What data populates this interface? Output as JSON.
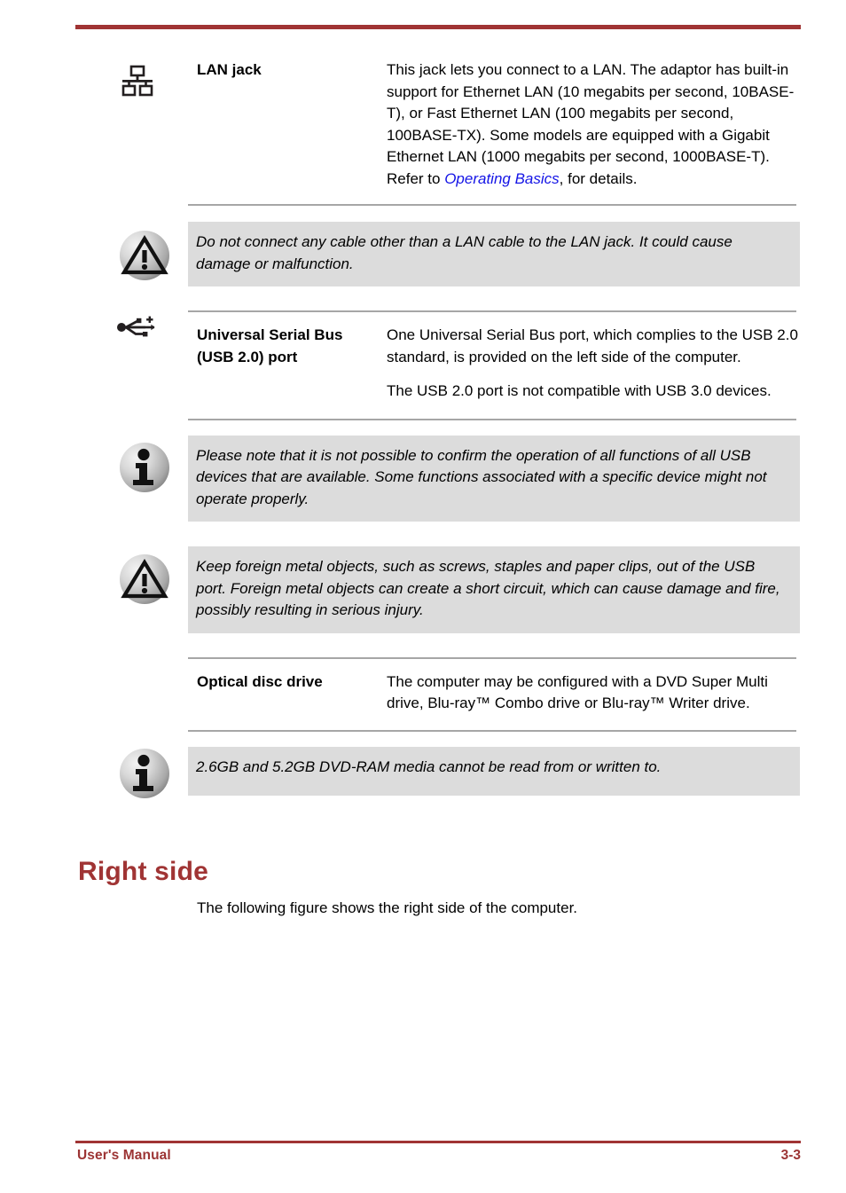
{
  "header": {
    "rule_color": "#a03434"
  },
  "footer": {
    "manual_label": "User's Manual",
    "page_number": "3-3",
    "color": "#9c3434"
  },
  "sections": {
    "lan": {
      "icon": "lan-jack-icon",
      "label": "LAN jack",
      "description_before_link": "This jack lets you connect to a LAN. The adaptor has built-in support for Ethernet LAN (10 megabits per second, 10BASE-T), or Fast Ethernet LAN (100 megabits per second, 100BASE-TX). Some models are equipped with a Gigabit Ethernet LAN (1000 megabits per second, 1000BASE-T). Refer to ",
      "link_text": "Operating Basics",
      "link_color": "#1414e6",
      "description_after_link": ", for details."
    },
    "lan_caution": {
      "icon": "warning-triangle-icon",
      "text": "Do not connect any cable other than a LAN cable to the LAN jack. It could cause damage or malfunction."
    },
    "usb": {
      "icon": "usb-plus-icon",
      "label_line1": "Universal Serial Bus",
      "label_line2": "(USB 2.0) port",
      "paragraph1": "One Universal Serial Bus port, which complies to the USB 2.0 standard, is provided on the left side of the computer.",
      "paragraph2": "The USB 2.0 port is not compatible with USB 3.0 devices."
    },
    "usb_info": {
      "icon": "information-icon",
      "text": "Please note that it is not possible to confirm the operation of all functions of all USB devices that are available. Some functions associated with a specific device might not operate properly."
    },
    "usb_caution": {
      "icon": "warning-triangle-icon",
      "text": "Keep foreign metal objects, such as screws, staples and paper clips, out of the USB port. Foreign metal objects can create a short circuit, which can cause damage and fire, possibly resulting in serious injury."
    },
    "optical": {
      "label": "Optical disc drive",
      "description": "The computer may be configured with a DVD Super Multi drive, Blu-ray™ Combo drive or Blu-ray™ Writer drive."
    },
    "optical_info": {
      "icon": "information-icon",
      "text": "2.6GB and 5.2GB DVD-RAM media cannot be read from or written to."
    },
    "right_side": {
      "heading": "Right side",
      "heading_color": "#a03434",
      "paragraph": "The following figure shows the right side of the computer."
    }
  }
}
